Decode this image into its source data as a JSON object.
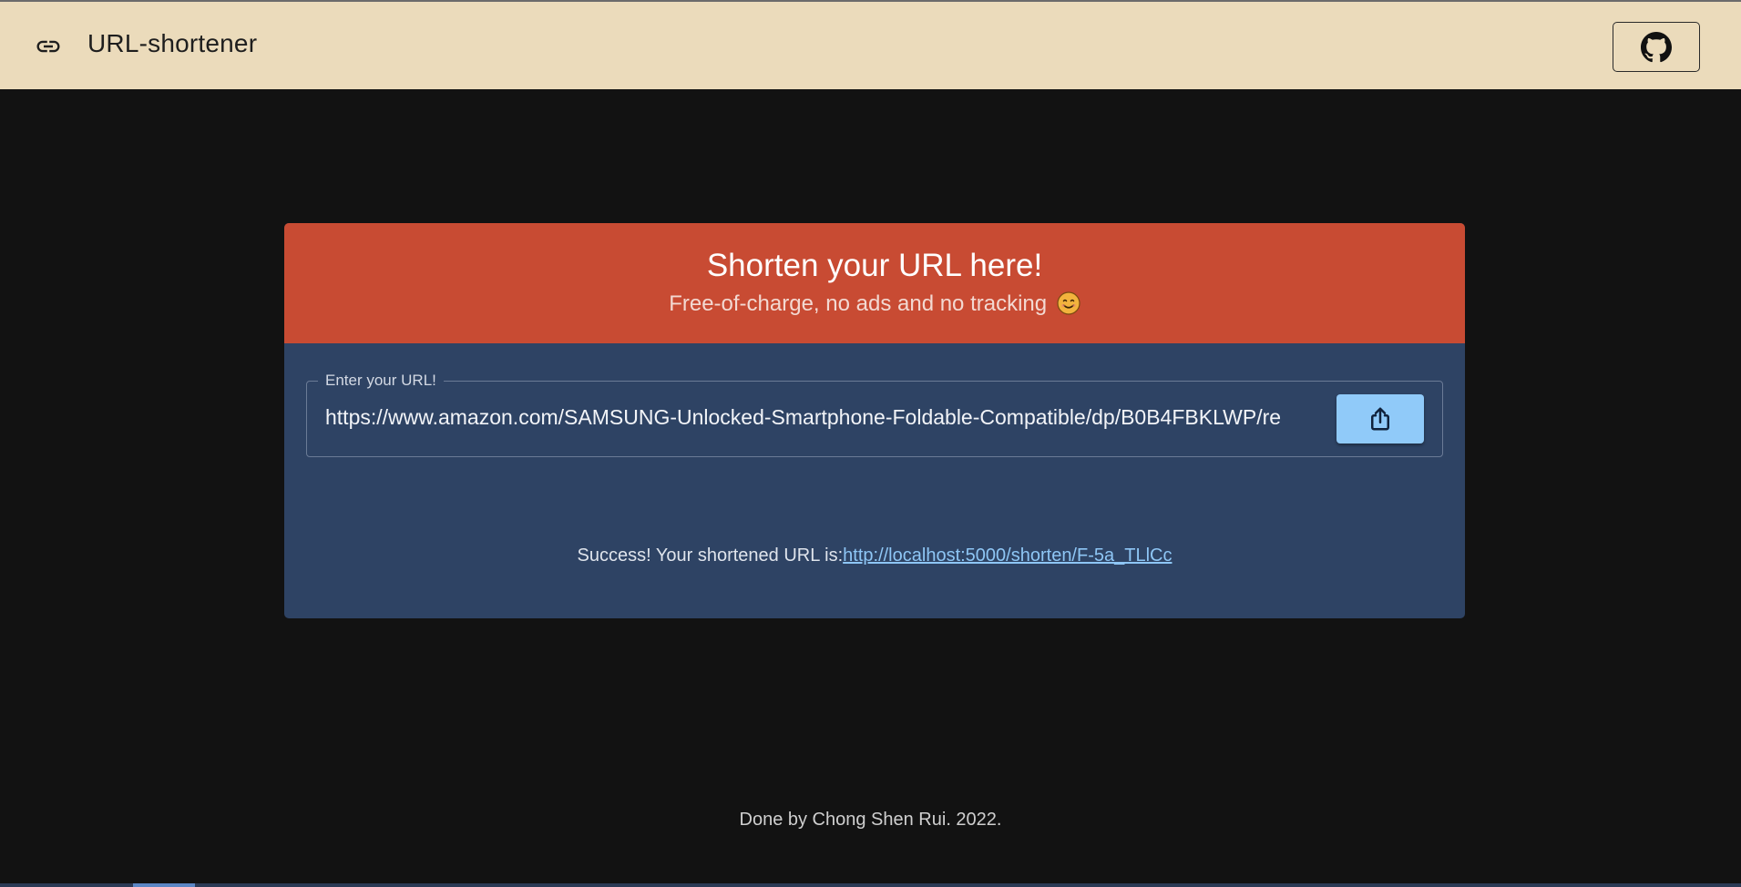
{
  "header": {
    "title": "URL-shortener",
    "brand_icon": "link-icon",
    "github_icon": "github-icon"
  },
  "card": {
    "title": "Shorten your URL here!",
    "subtitle": "Free-of-charge, no ads and no tracking",
    "subtitle_emoji_icon": "smiley-icon"
  },
  "form": {
    "label": "Enter your URL!",
    "value": "https://www.amazon.com/SAMSUNG-Unlocked-Smartphone-Foldable-Compatible/dp/B0B4FBKLWP/re",
    "submit_icon": "share-upload-icon"
  },
  "result": {
    "message": "Success! Your shortened URL is:",
    "link": "http://localhost:5000/shorten/F-5a_TLlCc"
  },
  "footer": {
    "text": "Done by Chong Shen Rui. 2022."
  },
  "colors": {
    "header_bg": "#ebdbbb",
    "page_bg": "#121212",
    "card_header_bg": "#c84b33",
    "card_body_bg": "#2e4364",
    "button_bg": "#90caf9",
    "link": "#8ec6f5"
  }
}
